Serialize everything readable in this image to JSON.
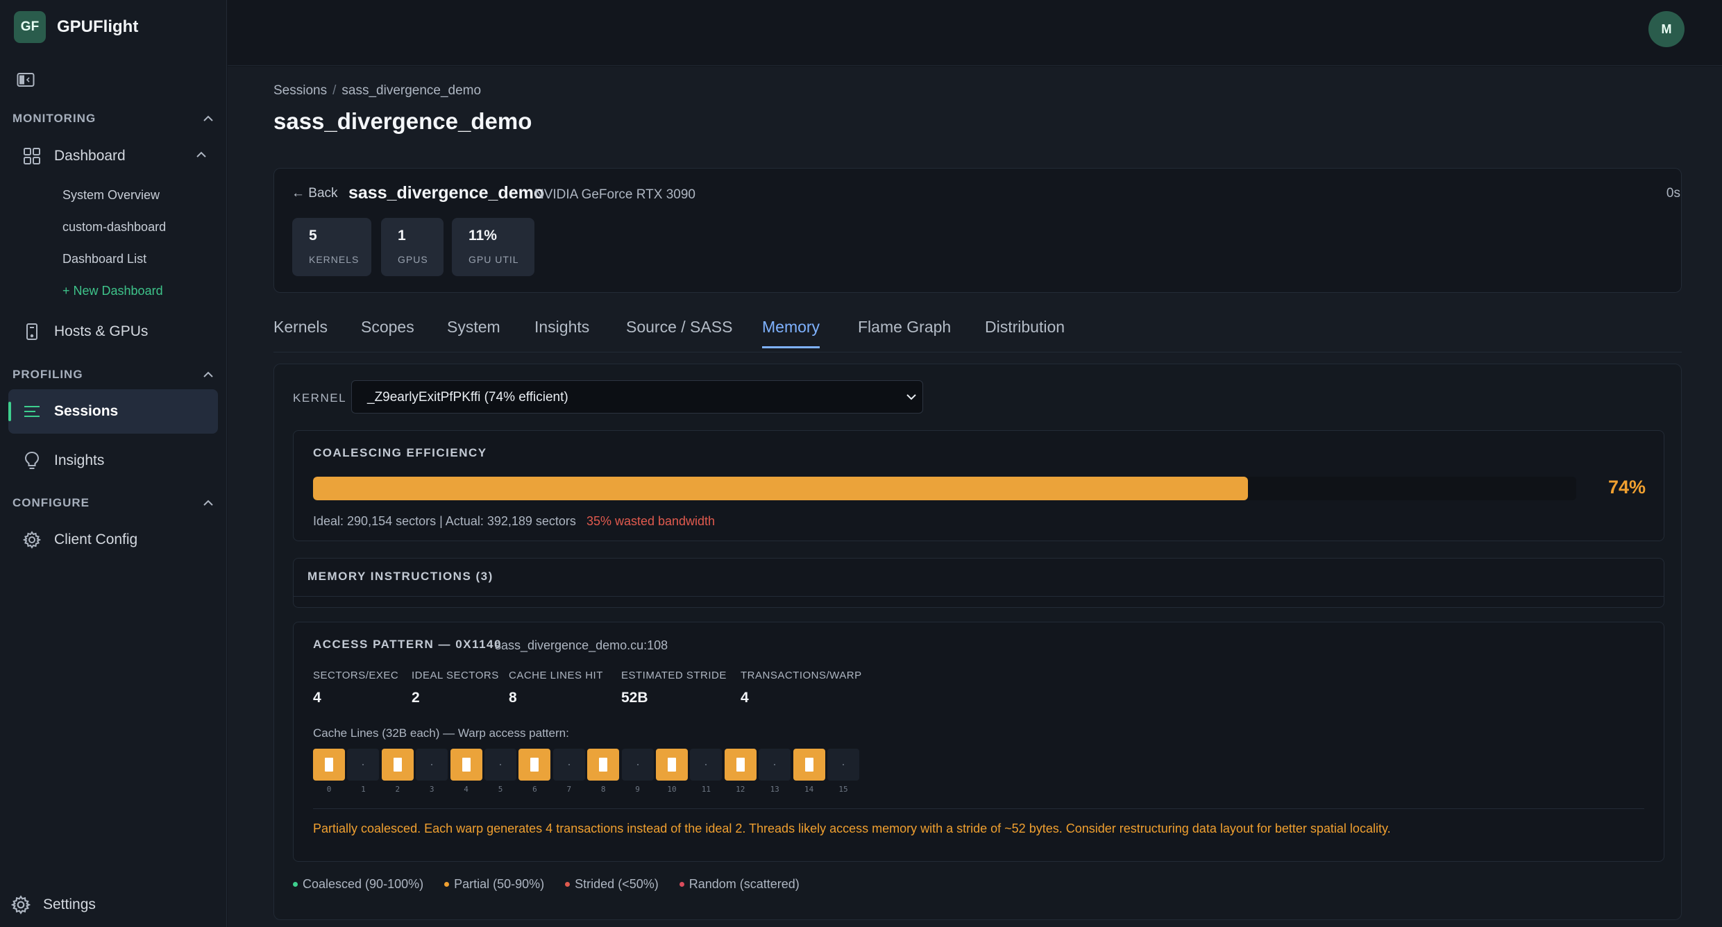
{
  "app": {
    "logo_text": "GF",
    "name": "GPUFlight"
  },
  "user": {
    "avatar_initial": "M"
  },
  "sidebar": {
    "sections": {
      "monitoring": "MONITORING",
      "profiling": "PROFILING",
      "configure": "CONFIGURE"
    },
    "dashboard": "Dashboard",
    "dashboard_children": [
      "System Overview",
      "custom-dashboard",
      "Dashboard List",
      "+ New Dashboard"
    ],
    "hosts": "Hosts & GPUs",
    "sessions": "Sessions",
    "insights": "Insights",
    "client_config": "Client Config",
    "settings": "Settings"
  },
  "breadcrumb": {
    "root": "Sessions",
    "sep": "/",
    "current": "sass_divergence_demo"
  },
  "page_title": "sass_divergence_demo",
  "session": {
    "back": "← Back",
    "name": "sass_divergence_demo",
    "gpu": "NVIDIA GeForce RTX 3090",
    "duration": "0s",
    "stats": [
      {
        "value": "5",
        "label": "KERNELS"
      },
      {
        "value": "1",
        "label": "GPUS"
      },
      {
        "value": "11%",
        "label": "GPU UTIL"
      }
    ]
  },
  "tabs": [
    "Kernels",
    "Scopes",
    "System",
    "Insights",
    "Source / SASS",
    "Memory",
    "Flame Graph",
    "Distribution"
  ],
  "active_tab": "Memory",
  "kernel": {
    "label": "KERNEL",
    "selected": "_Z9earlyExitPfPKffi (74% efficient)"
  },
  "coalescing": {
    "title": "COALESCING EFFICIENCY",
    "efficiency": 0.74,
    "efficiency_text": "74%",
    "detail": "Ideal: 290,154 sectors | Actual: 392,189 sectors",
    "waste": "35% wasted bandwidth"
  },
  "memory_instructions": {
    "title": "MEMORY INSTRUCTIONS (3)"
  },
  "access_pattern": {
    "title": "ACCESS PATTERN — 0X1140",
    "file": "sass_divergence_demo.cu:108",
    "metrics": [
      {
        "label": "SECTORS/EXEC",
        "value": "4"
      },
      {
        "label": "IDEAL SECTORS",
        "value": "2"
      },
      {
        "label": "CACHE LINES HIT",
        "value": "8"
      },
      {
        "label": "ESTIMATED STRIDE",
        "value": "52B"
      },
      {
        "label": "TRANSACTIONS/WARP",
        "value": "4"
      }
    ],
    "cache_caption": "Cache Lines (32B each) — Warp access pattern:",
    "cache_lines": [
      {
        "index": "0",
        "hit": true
      },
      {
        "index": "1",
        "hit": false
      },
      {
        "index": "2",
        "hit": true
      },
      {
        "index": "3",
        "hit": false
      },
      {
        "index": "4",
        "hit": true
      },
      {
        "index": "5",
        "hit": false
      },
      {
        "index": "6",
        "hit": true
      },
      {
        "index": "7",
        "hit": false
      },
      {
        "index": "8",
        "hit": true
      },
      {
        "index": "9",
        "hit": false
      },
      {
        "index": "10",
        "hit": true
      },
      {
        "index": "11",
        "hit": false
      },
      {
        "index": "12",
        "hit": true
      },
      {
        "index": "13",
        "hit": false
      },
      {
        "index": "14",
        "hit": true
      },
      {
        "index": "15",
        "hit": false
      }
    ],
    "message": "Partially coalesced. Each warp generates 4 transactions instead of the ideal 2. Threads likely access memory with a stride of ~52 bytes. Consider restructuring data layout for better spatial locality."
  },
  "legend": [
    {
      "label": "Coalesced (90-100%)",
      "color": "#3ecf8e"
    },
    {
      "label": "Partial (50-90%)",
      "color": "#f0a030"
    },
    {
      "label": "Strided (<50%)",
      "color": "#e05a4e"
    },
    {
      "label": "Random (scattered)",
      "color": "#d94c5c"
    }
  ],
  "colors": {
    "accent": "#7fb2ff",
    "brand": "#2a5c4c",
    "warning": "#f0a030",
    "danger": "#e05a4e",
    "success": "#3ecf8e"
  }
}
